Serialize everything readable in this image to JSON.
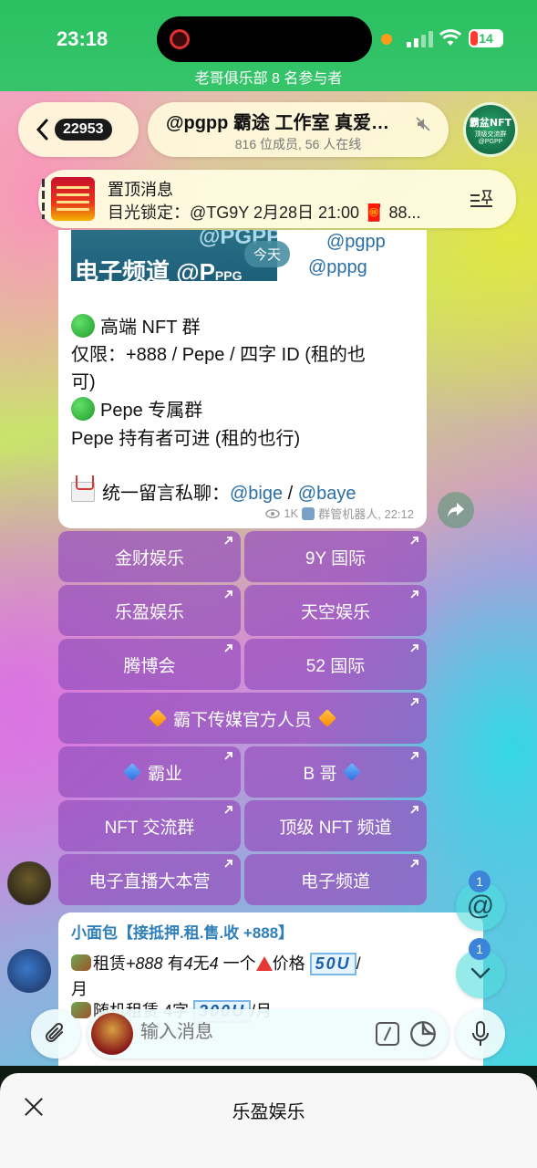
{
  "status_bar": {
    "time": "23:18",
    "battery": "14",
    "call_banner": "老哥俱乐部 8 名参与者"
  },
  "header": {
    "unread_count": "22953",
    "title": "@pgpp 霸途 工作室 真爱…",
    "subtitle": "816 位成员, 56 人在线",
    "avatar_text": "霸盆NFT",
    "avatar_subtext": "顶级交流群",
    "avatar_tag": "@PGPP"
  },
  "pinned": {
    "title": "置顶消息",
    "text": "目光锁定：@TG9Y 2月28日 21:00 🧧 88..."
  },
  "message": {
    "banner_top": "@PGPP",
    "banner_main": "电子频道 @P",
    "banner_small": "PPG",
    "link_a": "@pgpp",
    "link_b": "@pppg",
    "date_pill": "今天",
    "line1": "高端 NFT 群",
    "line2": "仅限：+888 / Pepe / 四字 ID (租的也",
    "line3": "可)",
    "line4": "Pepe 专属群",
    "line5": "Pepe 持有者可进 (租的也行)",
    "line6_prefix": "统一留言私聊：",
    "mention1": "@bige",
    "separator": " / ",
    "mention2": "@baye",
    "views": "1K",
    "author": "群管机器人, 22:12"
  },
  "buttons": [
    {
      "label": "金财娱乐"
    },
    {
      "label": "9Y 国际"
    },
    {
      "label": "乐盈娱乐"
    },
    {
      "label": "天空娱乐"
    },
    {
      "label": "腾博会"
    },
    {
      "label": "52 国际"
    },
    {
      "label": "霸下传媒官方人员"
    },
    {
      "label": "霸业"
    },
    {
      "label": "B 哥"
    },
    {
      "label": "NFT 交流群"
    },
    {
      "label": "顶级 NFT 频道"
    },
    {
      "label": "电子直播大本营"
    },
    {
      "label": "电子频道"
    }
  ],
  "next_message": {
    "sender": "小面包【接抵押.租.售.收 +888】",
    "line1_a": "租赁",
    "line1_b": "+888",
    "line1_c": "有",
    "line1_d": "4",
    "line1_e": "无",
    "line1_f": "4",
    "line1_g": " 一个",
    "line1_h": "价格",
    "line1_price": "50U",
    "line1_end": "/",
    "line2": "月",
    "line3_a": "随机租赁 4字",
    "line3_price": "300U",
    "line3_end": "/月"
  },
  "floating": {
    "mention_badge": "1",
    "down_badge": "1",
    "mention_symbol": "@"
  },
  "input": {
    "placeholder": "输入消息"
  },
  "sheet": {
    "title": "乐盈娱乐"
  }
}
